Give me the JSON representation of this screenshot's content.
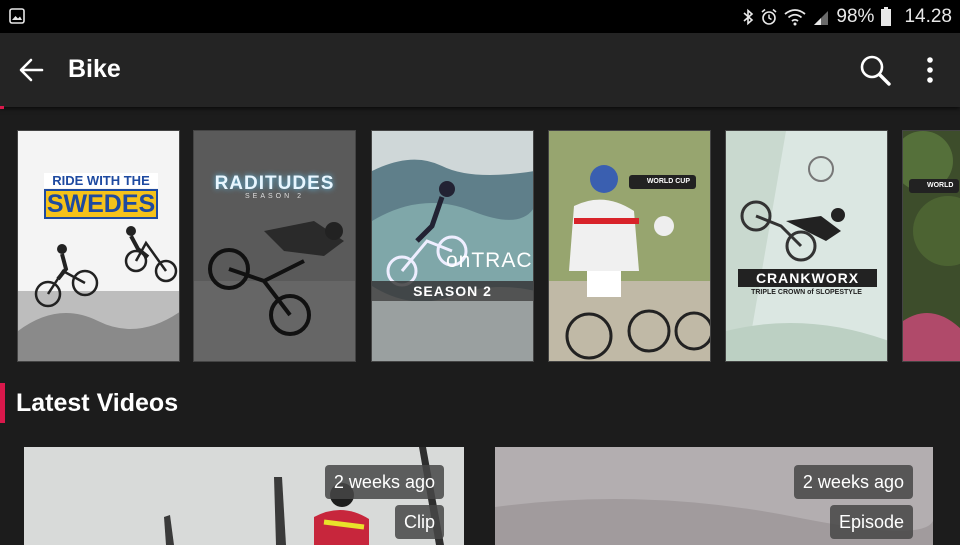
{
  "status_bar": {
    "battery": "98%",
    "time": "14.28"
  },
  "app_bar": {
    "title": "Bike"
  },
  "carousel": {
    "cards": [
      {
        "title_top": "RIDE WITH THE",
        "title_main": "SWEDES"
      },
      {
        "title": "RADITUDES",
        "subtitle": "SEASON 2"
      },
      {
        "title": "onTRACK",
        "banner": "SEASON 2"
      },
      {
        "badge": "WORLD CUP"
      },
      {
        "title": "CRANKWORX",
        "subtitle": "TRIPLE CROWN of SLOPESTYLE"
      },
      {
        "badge": "WORLD"
      }
    ]
  },
  "section": {
    "title": "Latest Videos"
  },
  "videos": [
    {
      "age": "2 weeks ago",
      "type": "Clip"
    },
    {
      "age": "2 weeks ago",
      "type": "Episode"
    }
  ],
  "colors": {
    "accent": "#d9184b",
    "background": "#1c1c1c",
    "app_bar": "#242424"
  }
}
